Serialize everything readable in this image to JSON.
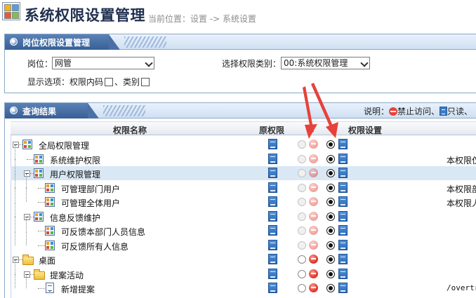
{
  "header": {
    "title": "系统权限设置管理",
    "breadcrumb": "当前位置：设置 -> 系统设置"
  },
  "settings_panel": {
    "title": "岗位权限设置管理",
    "position_label": "岗位：",
    "position_value": "网管",
    "category_label": "选择权限类别：",
    "category_value": "00:系统权限管理",
    "display_label": "显示选项：权限内码",
    "category_checkbox_label": "、类别"
  },
  "results_panel": {
    "title": "查询结果",
    "legend_prefix": "说明：",
    "legend_forbid": "禁止访问、",
    "legend_readonly": "只读、"
  },
  "columns": {
    "name": "权限名称",
    "original": "原权限",
    "setting": "权限设置"
  },
  "rows": [
    {
      "label": "全局权限管理",
      "desc": ""
    },
    {
      "label": "系统维护权限",
      "desc": "本权限仅"
    },
    {
      "label": "用户权限管理",
      "desc": ""
    },
    {
      "label": "可管理部门用户",
      "desc": "本权限部"
    },
    {
      "label": "可管理全体用户",
      "desc": "本权限人"
    },
    {
      "label": "信息反馈维护",
      "desc": ""
    },
    {
      "label": "可反馈本部门人员信息",
      "desc": ""
    },
    {
      "label": "可反馈所有人信息",
      "desc": ""
    },
    {
      "label": "桌面",
      "desc": ""
    },
    {
      "label": "提案活动",
      "desc": ""
    },
    {
      "label": "新增提案",
      "desc": "/overtr"
    }
  ],
  "colors": {
    "title": "#1f2f4f",
    "panel_border": "#8aa9c9",
    "selected_row": "#d9e8f4",
    "annotation_arrow": "#e8413a"
  }
}
